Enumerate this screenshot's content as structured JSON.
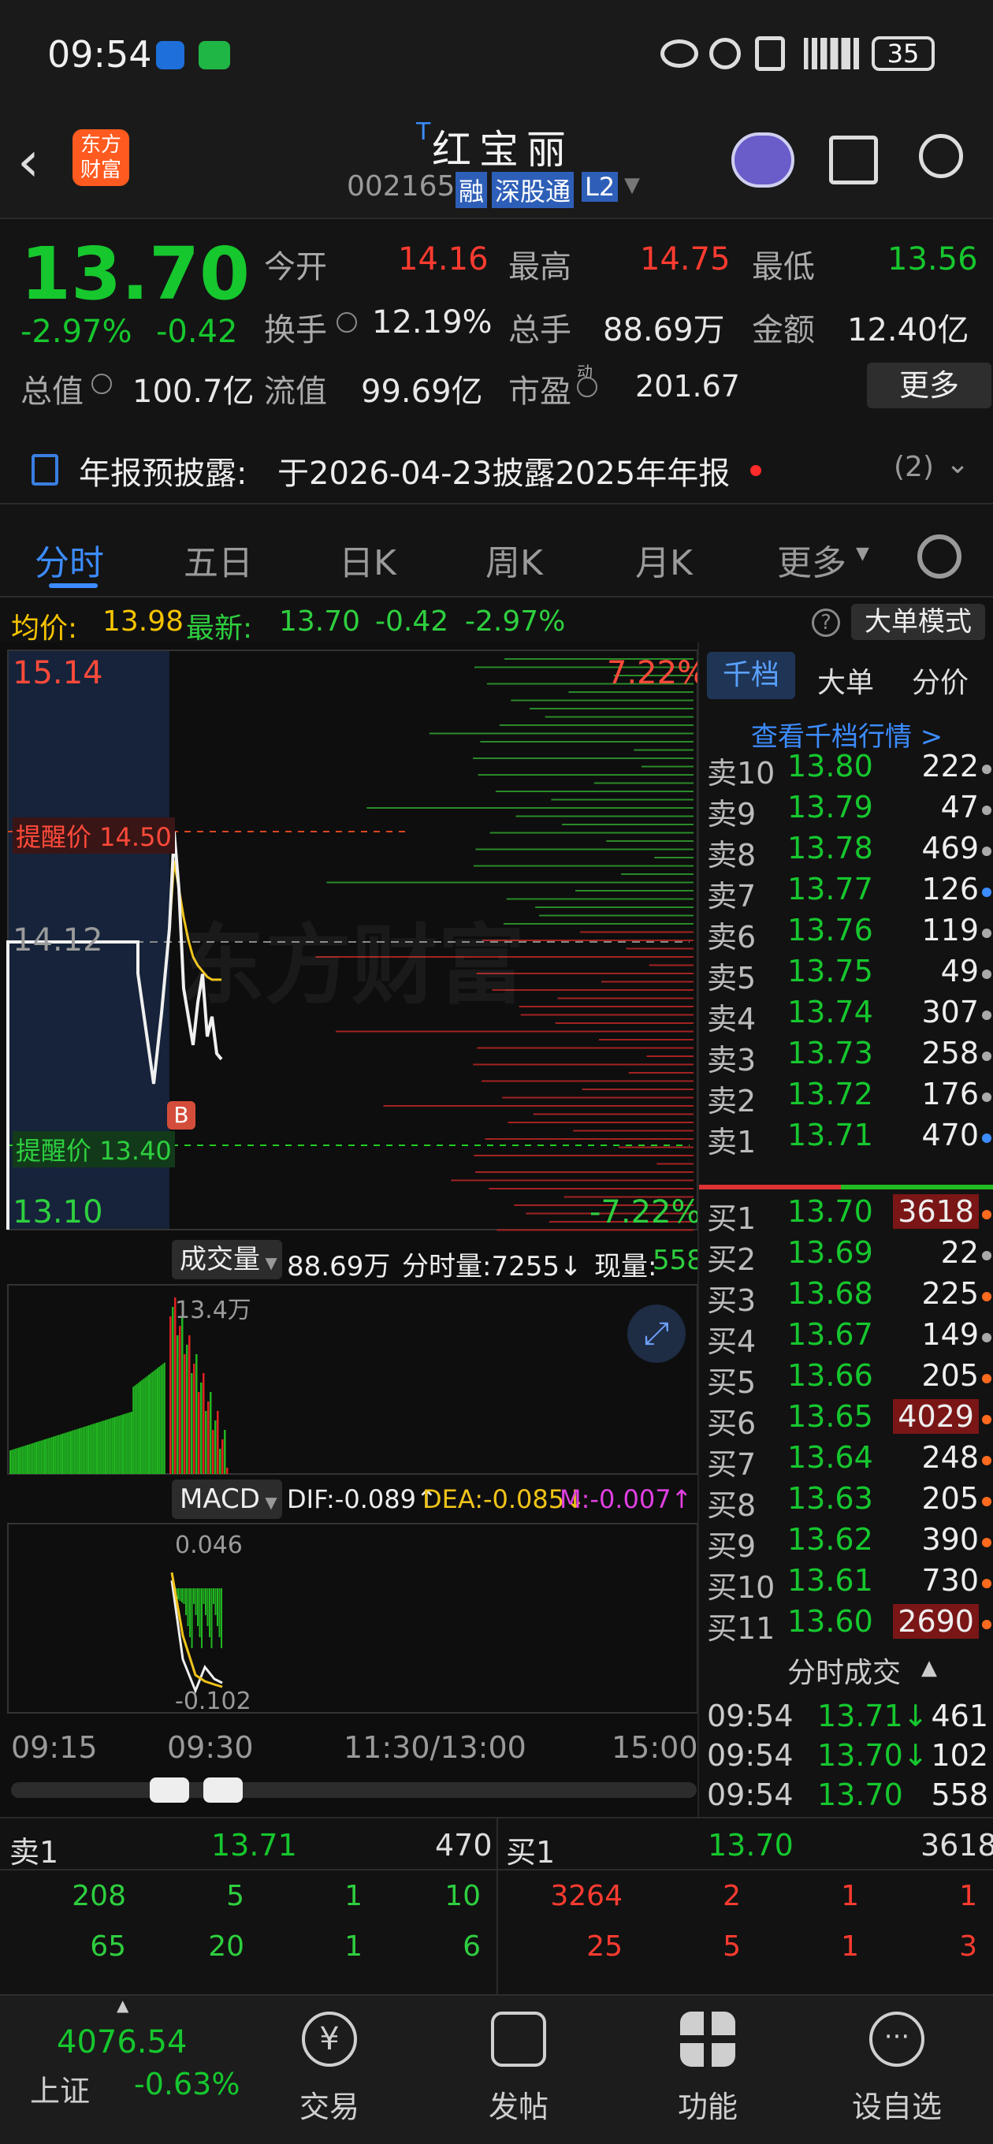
{
  "status": {
    "time": "09:54",
    "battery": "35"
  },
  "header": {
    "logo_line1": "东方",
    "logo_line2": "财富",
    "title_mark": "T",
    "title": "红宝丽",
    "code": "002165",
    "badges": [
      "融",
      "深股通",
      "L2"
    ]
  },
  "quote": {
    "price": "13.70",
    "change_pct": "-2.97%",
    "change": "-0.42",
    "open_label": "今开",
    "open": "14.16",
    "high_label": "最高",
    "high": "14.75",
    "low_label": "最低",
    "low": "13.56",
    "turnover_label": "换手",
    "turnover": "12.19%",
    "volume_label": "总手",
    "volume": "88.69万",
    "amount_label": "金额",
    "amount": "12.40亿",
    "mktcap_label": "总值",
    "mktcap": "100.7亿",
    "float_label": "流值",
    "float": "99.69亿",
    "pe_label": "市盈",
    "pe_mark": "动",
    "pe": "201.67",
    "more_button": "更多"
  },
  "notice": {
    "label": "年报预披露:",
    "text": "于2026-04-23披露2025年年报",
    "count": "(2)"
  },
  "tabs": [
    "分时",
    "五日",
    "日K",
    "周K",
    "月K",
    "更多"
  ],
  "infobar": {
    "avg_label": "均价:",
    "avg": "13.98",
    "latest_label": "最新:",
    "latest": "13.70",
    "chg": "-0.42",
    "pct": "-2.97%",
    "mode_button": "大单模式"
  },
  "chart": {
    "y_top": "15.14",
    "y_mid": "14.12",
    "y_bot": "13.10",
    "pct_top": "7.22%",
    "pct_bot": "-7.22%",
    "alert_high": "提醒价 14.50",
    "alert_low": "提醒价 13.40",
    "buy_marker": "B",
    "watermark": "东方财富",
    "volume_selector": "成交量",
    "volume_total": "88.69万",
    "tick_volume": "分时量:7255↓",
    "current_volume_label": "现量:",
    "current_volume": "558",
    "volume_peak": "13.4万",
    "macd_selector": "MACD",
    "dif": "DIF:-0.089↑",
    "dea": "DEA:-0.085↓",
    "m": "M:-0.007↑",
    "macd_top": "0.046",
    "macd_bot": "-0.102",
    "time_labels": [
      "09:15",
      "09:30",
      "11:30/13:00",
      "15:00"
    ]
  },
  "chart_data": {
    "type": "line",
    "title": "",
    "x": [
      "09:25",
      "09:30",
      "09:31",
      "09:32",
      "09:33",
      "09:34",
      "09:35",
      "09:36",
      "09:37",
      "09:38",
      "09:39",
      "09:40"
    ],
    "series": [
      {
        "values": [
          14.16,
          14.5,
          14.3,
          13.95,
          13.85,
          13.75,
          13.9,
          14.0,
          13.78,
          13.85,
          13.72,
          13.7
        ]
      },
      {
        "values": [
          14.16,
          14.4,
          14.3,
          14.2,
          14.12,
          14.06,
          14.03,
          14.01,
          13.99,
          13.98,
          13.98,
          13.98
        ]
      }
    ],
    "ylim": [
      13.1,
      15.14
    ],
    "grid": true,
    "legend": "none"
  },
  "book": {
    "tabs": [
      "千档",
      "大单",
      "分价"
    ],
    "link": "查看千档行情 >",
    "asks": [
      {
        "label": "卖10",
        "price": "13.80",
        "vol": "222"
      },
      {
        "label": "卖9",
        "price": "13.79",
        "vol": "47"
      },
      {
        "label": "卖8",
        "price": "13.78",
        "vol": "469"
      },
      {
        "label": "卖7",
        "price": "13.77",
        "vol": "126"
      },
      {
        "label": "卖6",
        "price": "13.76",
        "vol": "119"
      },
      {
        "label": "卖5",
        "price": "13.75",
        "vol": "49"
      },
      {
        "label": "卖4",
        "price": "13.74",
        "vol": "307"
      },
      {
        "label": "卖3",
        "price": "13.73",
        "vol": "258"
      },
      {
        "label": "卖2",
        "price": "13.72",
        "vol": "176"
      },
      {
        "label": "卖1",
        "price": "13.71",
        "vol": "470"
      }
    ],
    "bids": [
      {
        "label": "买1",
        "price": "13.70",
        "vol": "3618"
      },
      {
        "label": "买2",
        "price": "13.69",
        "vol": "22"
      },
      {
        "label": "买3",
        "price": "13.68",
        "vol": "225"
      },
      {
        "label": "买4",
        "price": "13.67",
        "vol": "149"
      },
      {
        "label": "买5",
        "price": "13.66",
        "vol": "205"
      },
      {
        "label": "买6",
        "price": "13.65",
        "vol": "4029"
      },
      {
        "label": "买7",
        "price": "13.64",
        "vol": "248"
      },
      {
        "label": "买8",
        "price": "13.63",
        "vol": "205"
      },
      {
        "label": "买9",
        "price": "13.62",
        "vol": "390"
      },
      {
        "label": "买10",
        "price": "13.61",
        "vol": "730"
      },
      {
        "label": "买11",
        "price": "13.60",
        "vol": "2690"
      }
    ],
    "trades_title": "分时成交",
    "trades": [
      {
        "time": "09:54",
        "price": "13.71↓",
        "vol": "461"
      },
      {
        "time": "09:54",
        "price": "13.70↓",
        "vol": "102"
      },
      {
        "time": "09:54",
        "price": "13.70",
        "vol": "558"
      }
    ]
  },
  "bottombook": {
    "sell_label": "卖1",
    "sell_price": "13.71",
    "sell_vol": "470",
    "buy_label": "买1",
    "buy_price": "13.70",
    "buy_vol": "3618",
    "sell_rows": [
      [
        "208",
        "5",
        "1",
        "10"
      ],
      [
        "65",
        "20",
        "1",
        "6"
      ]
    ],
    "buy_rows": [
      [
        "3264",
        "2",
        "1",
        "1"
      ],
      [
        "25",
        "5",
        "1",
        "3"
      ]
    ]
  },
  "nav": {
    "index_value": "4076.54",
    "index_name": "上证",
    "index_pct": "-0.63%",
    "items": [
      "交易",
      "发帖",
      "功能",
      "设自选"
    ]
  }
}
